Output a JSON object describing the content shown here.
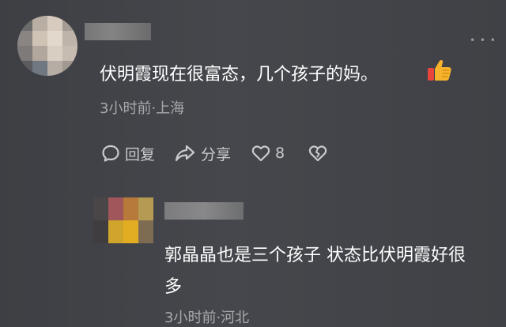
{
  "comment": {
    "text": "伏明霞现在很富态，几个孩子的妈。",
    "meta": "3小时前·上海",
    "more_icon": "more-dots-icon",
    "emoji": "thumbs-up-icon",
    "actions": {
      "reply_label": "回复",
      "share_label": "分享",
      "like_count": "8",
      "reply_icon": "speech-bubble-icon",
      "share_icon": "share-arrow-icon",
      "like_icon": "heart-icon",
      "dislike_icon": "broken-heart-icon"
    }
  },
  "reply": {
    "text": "郭晶晶也是三个孩子 状态比伏明霞好很多",
    "meta": "3小时前·河北"
  },
  "colors": {
    "background": "#424449",
    "secondary_text": "#a8a9ad",
    "action_text": "#c9cacd"
  }
}
